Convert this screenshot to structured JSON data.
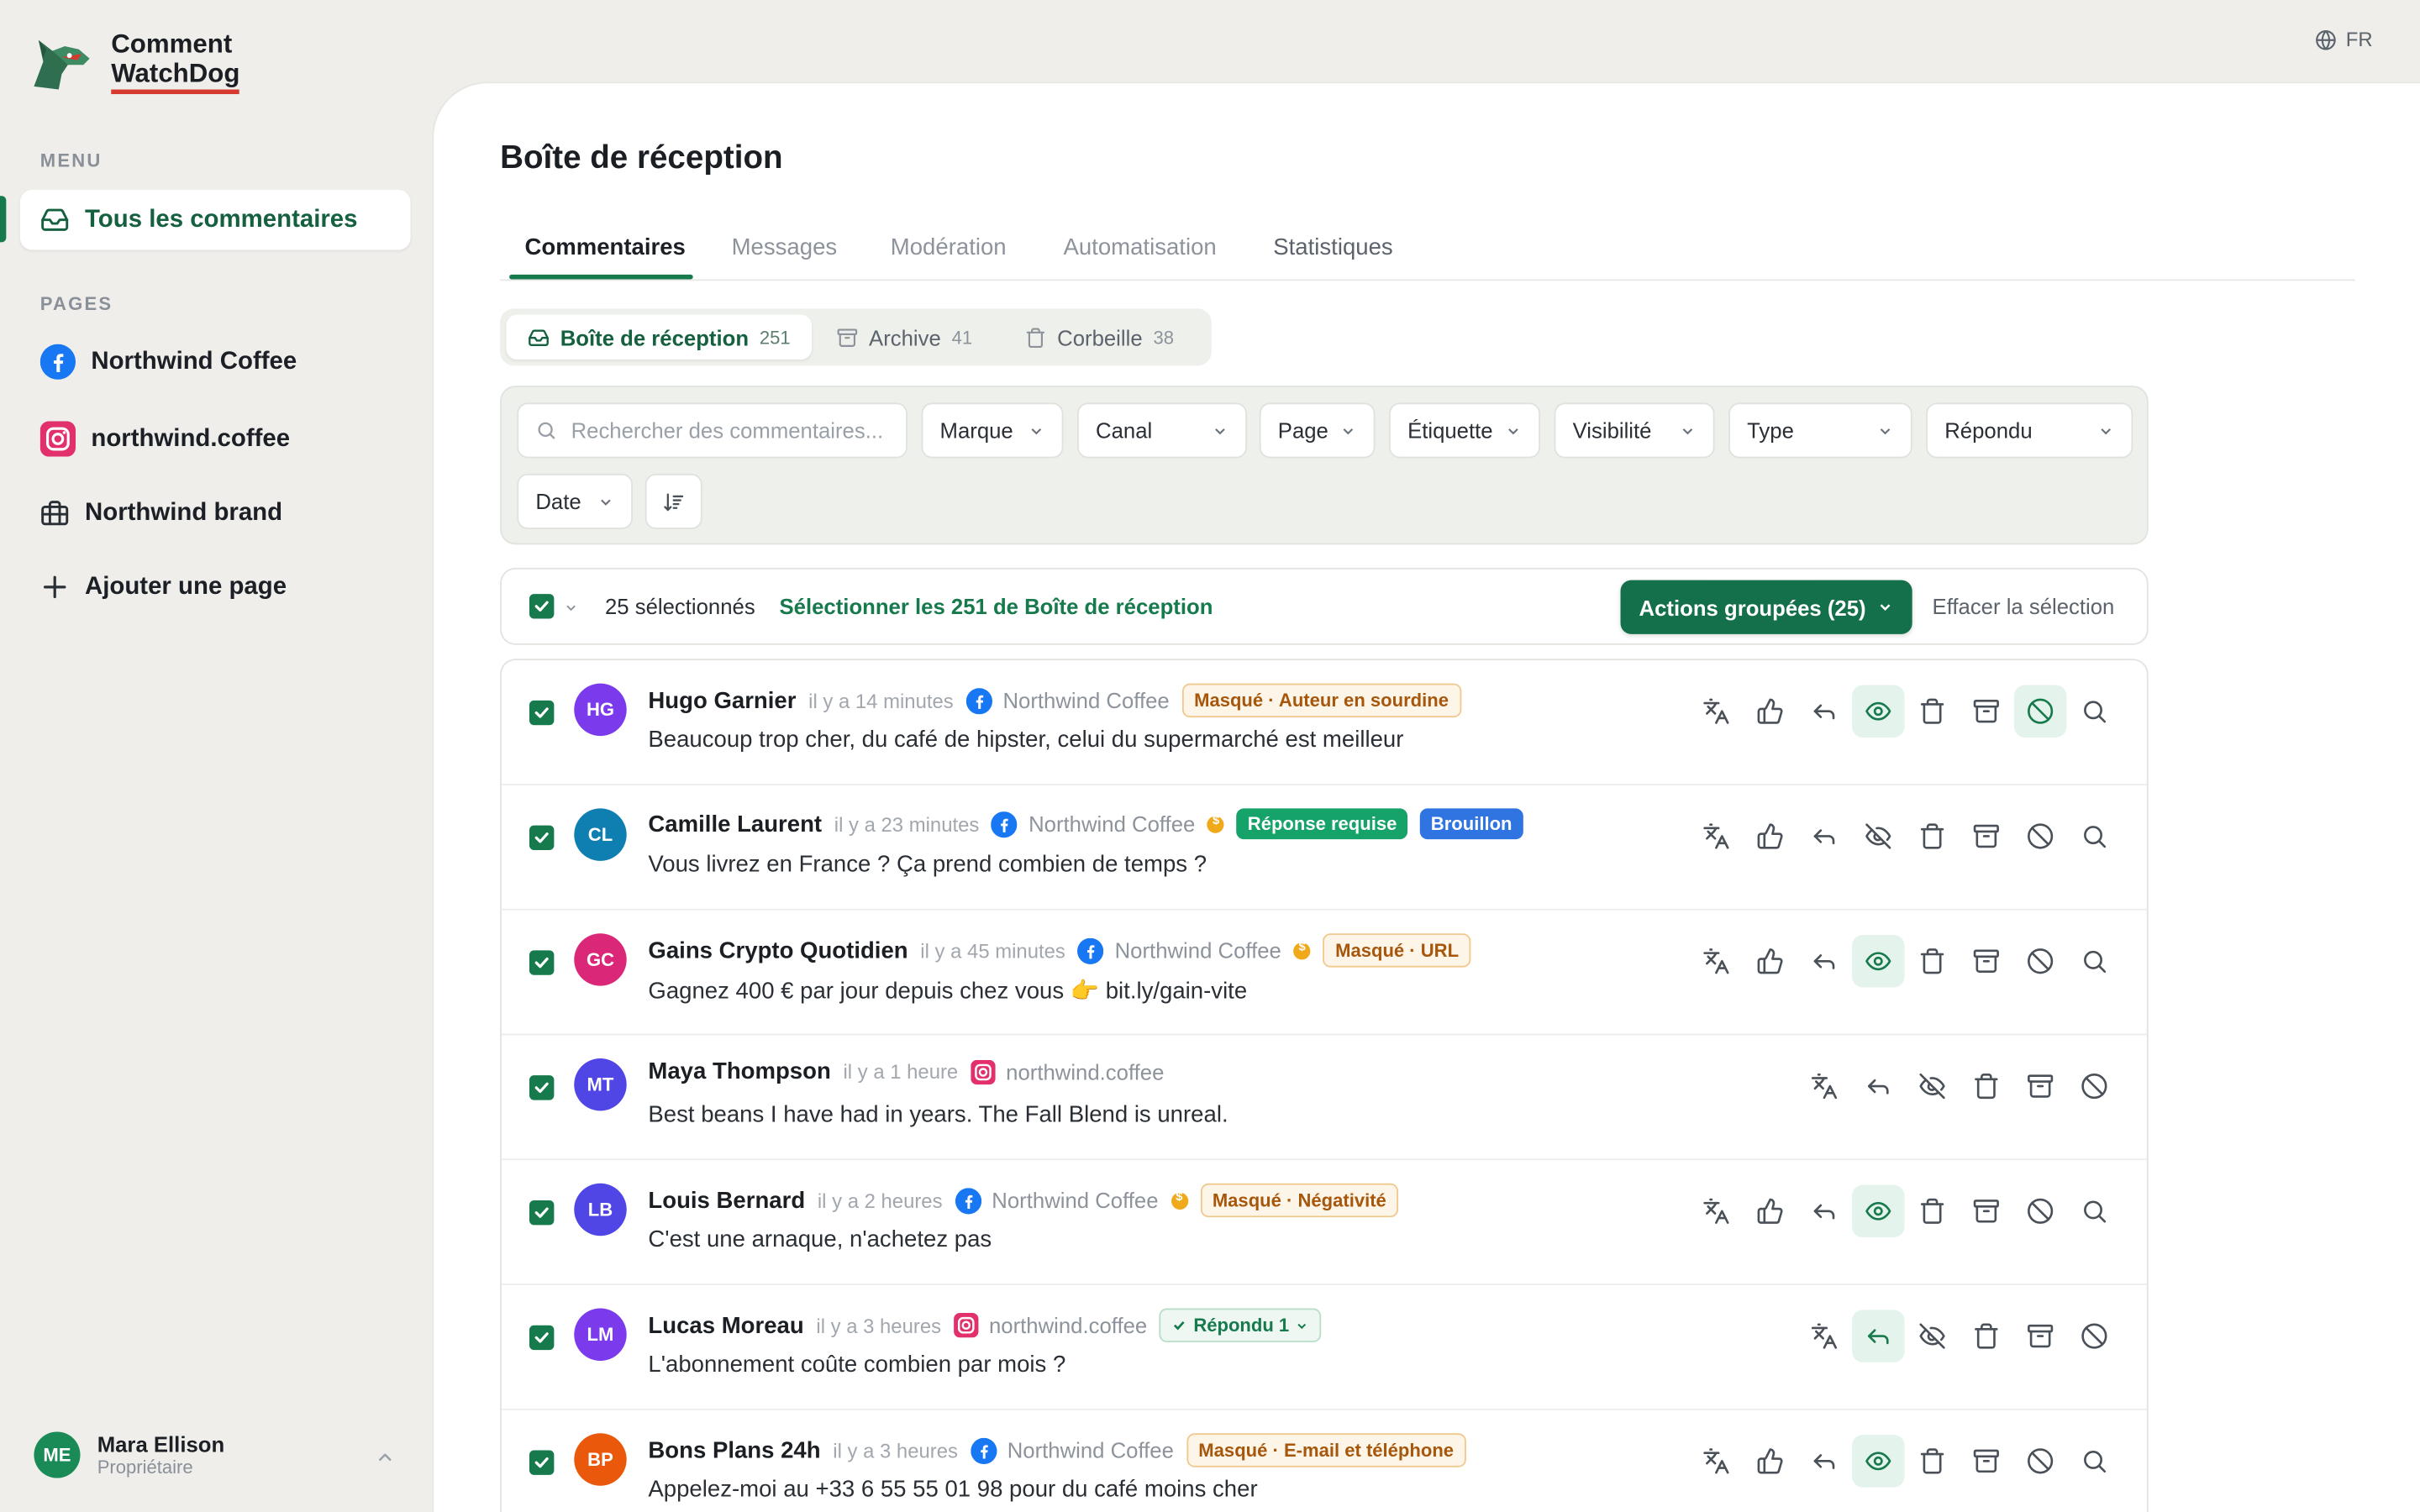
{
  "app": {
    "logo_line1": "Comment",
    "logo_line2": "WatchDog",
    "language": "FR"
  },
  "sidebar": {
    "menu_label": "MENU",
    "active_item": "Tous les commentaires",
    "pages_label": "PAGES",
    "pages": [
      {
        "label": "Northwind Coffee",
        "icon": "facebook-icon"
      },
      {
        "label": "northwind.coffee",
        "icon": "instagram-icon"
      },
      {
        "label": "Northwind brand",
        "icon": "briefcase-icon"
      },
      {
        "label": "Ajouter une page",
        "icon": "plus-icon"
      }
    ],
    "user": {
      "initials": "ME",
      "name": "Mara Ellison",
      "role": "Propriétaire"
    }
  },
  "main": {
    "title": "Boîte de réception",
    "tabs": [
      "Commentaires",
      "Messages",
      "Modération",
      "Automatisation",
      "Statistiques"
    ],
    "folders": [
      {
        "label": "Boîte de réception",
        "count": "251"
      },
      {
        "label": "Archive",
        "count": "41"
      },
      {
        "label": "Corbeille",
        "count": "38"
      }
    ],
    "filters": {
      "search_placeholder": "Rechercher des commentaires...",
      "dropdowns": [
        "Marque",
        "Canal",
        "Page",
        "Étiquette",
        "Visibilité",
        "Type",
        "Répondu",
        "Date"
      ]
    },
    "selection": {
      "count_text": "25 sélectionnés",
      "select_all": "Sélectionner les 251 de Boîte de réception",
      "bulk_actions": "Actions groupées (25)",
      "clear": "Effacer la sélection"
    },
    "comments": [
      {
        "initials": "HG",
        "color": "#7c3aed",
        "author": "Hugo Garnier",
        "time": "il y a 14 minutes",
        "channel": "Northwind Coffee",
        "platform": "facebook",
        "coin": false,
        "badges": [
          {
            "text": "Masqué · Auteur en sourdine",
            "kind": "warn"
          }
        ],
        "text": "Beaucoup trop cher, du café de hipster, celui du supermarché est meilleur",
        "visible_on": true,
        "block_on": true,
        "full": true
      },
      {
        "initials": "CL",
        "color": "#0e7fb0",
        "author": "Camille Laurent",
        "time": "il y a 23 minutes",
        "channel": "Northwind Coffee",
        "platform": "facebook",
        "coin": true,
        "badges": [
          {
            "text": "Réponse requise",
            "kind": "green"
          },
          {
            "text": "Brouillon",
            "kind": "blue"
          }
        ],
        "text": "Vous livrez en France ? Ça prend combien de temps ?",
        "visible_on": false,
        "block_on": false,
        "full": true
      },
      {
        "initials": "GC",
        "color": "#db2777",
        "author": "Gains Crypto Quotidien",
        "time": "il y a 45 minutes",
        "channel": "Northwind Coffee",
        "platform": "facebook",
        "coin": true,
        "badges": [
          {
            "text": "Masqué · URL",
            "kind": "warn"
          }
        ],
        "text": "Gagnez 400 € par jour depuis chez vous 👉 bit.ly/gain-vite",
        "visible_on": true,
        "block_on": false,
        "full": true
      },
      {
        "initials": "MT",
        "color": "#4f46e5",
        "author": "Maya Thompson",
        "time": "il y a 1 heure",
        "channel": "northwind.coffee",
        "platform": "instagram",
        "coin": false,
        "badges": [],
        "text": "Best beans I have had in years. The Fall Blend is unreal.",
        "visible_on": false,
        "block_on": false,
        "full": false
      },
      {
        "initials": "LB",
        "color": "#4f46e5",
        "author": "Louis Bernard",
        "time": "il y a 2 heures",
        "channel": "Northwind Coffee",
        "platform": "facebook",
        "coin": true,
        "badges": [
          {
            "text": "Masqué · Négativité",
            "kind": "warn"
          }
        ],
        "text": "C'est une arnaque, n'achetez pas",
        "visible_on": true,
        "block_on": false,
        "full": true
      },
      {
        "initials": "LM",
        "color": "#7c3aed",
        "author": "Lucas Moreau",
        "time": "il y a 3 heures",
        "channel": "northwind.coffee",
        "platform": "instagram",
        "coin": false,
        "badges": [
          {
            "text": "Répondu 1",
            "kind": "replied"
          }
        ],
        "text": "L'abonnement coûte combien par mois ?",
        "visible_on": false,
        "block_on": false,
        "full": false,
        "reply_on": true
      },
      {
        "initials": "BP",
        "color": "#ea580c",
        "author": "Bons Plans 24h",
        "time": "il y a 3 heures",
        "channel": "Northwind Coffee",
        "platform": "facebook",
        "coin": false,
        "badges": [
          {
            "text": "Masqué · E-mail et téléphone",
            "kind": "warn"
          }
        ],
        "text": "Appelez-moi au +33 6 55 55 01 98 pour du café moins cher",
        "visible_on": true,
        "block_on": false,
        "full": true
      }
    ]
  },
  "colors": {
    "accent": "#167a4c",
    "bulk_button": "#13704a",
    "warning": "#a6570c",
    "logo_underline": "#d63a2f"
  }
}
